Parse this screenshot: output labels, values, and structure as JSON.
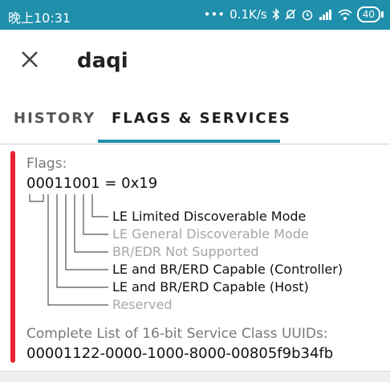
{
  "status_bar": {
    "time": "晚上10:31",
    "network_speed": "0.1K/s",
    "battery": "40",
    "icons": [
      "dots-icon",
      "bluetooth-icon",
      "mute-icon",
      "alarm-icon",
      "signal-icon",
      "wifi-icon",
      "battery-icon"
    ]
  },
  "app_bar": {
    "close_icon": "close-icon",
    "title": "daqi"
  },
  "tabs": [
    {
      "label": "HISTORY",
      "selected": false
    },
    {
      "label": "FLAGS & SERVICES",
      "selected": true
    }
  ],
  "flags": {
    "title": "Flags:",
    "value": "00011001 = 0x19",
    "bits": [
      {
        "label": "LE Limited Discoverable Mode",
        "set": true
      },
      {
        "label": "LE General Discoverable Mode",
        "set": false
      },
      {
        "label": "BR/EDR Not Supported",
        "set": false
      },
      {
        "label": "LE and BR/ERD Capable (Controller)",
        "set": true
      },
      {
        "label": "LE and BR/ERD Capable (Host)",
        "set": true
      },
      {
        "label": "Reserved",
        "set": false
      }
    ]
  },
  "services": {
    "title": "Complete List of 16-bit Service Class UUIDs:",
    "value": "00001122-0000-1000-8000-00805f9b34fb"
  },
  "colors": {
    "accent": "#1f8fab",
    "indicator": "#e62330",
    "muted_text": "#a6a6a6"
  }
}
